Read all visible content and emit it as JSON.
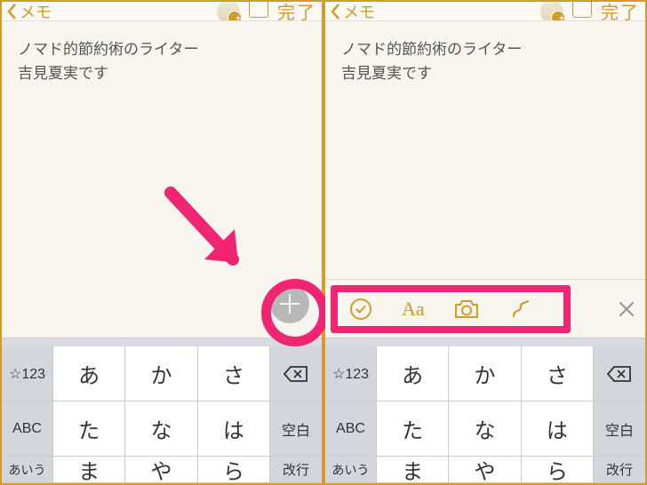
{
  "nav": {
    "back_label": "メモ",
    "done_label": "完了"
  },
  "note": {
    "line1": "ノマド的節約術のライター",
    "line2": "吉見夏実です"
  },
  "keyboard": {
    "mode_num": "☆123",
    "mode_abc": "ABC",
    "mode_kana": "あいう",
    "space": "空白",
    "return": "改行",
    "row1": {
      "k1": "あ",
      "k2": "か",
      "k3": "さ"
    },
    "row2": {
      "k1": "た",
      "k2": "な",
      "k3": "は"
    },
    "row3": {
      "k1": "ま",
      "k2": "や",
      "k3": "ら"
    }
  },
  "toolbar": {
    "aa": "Aa"
  }
}
